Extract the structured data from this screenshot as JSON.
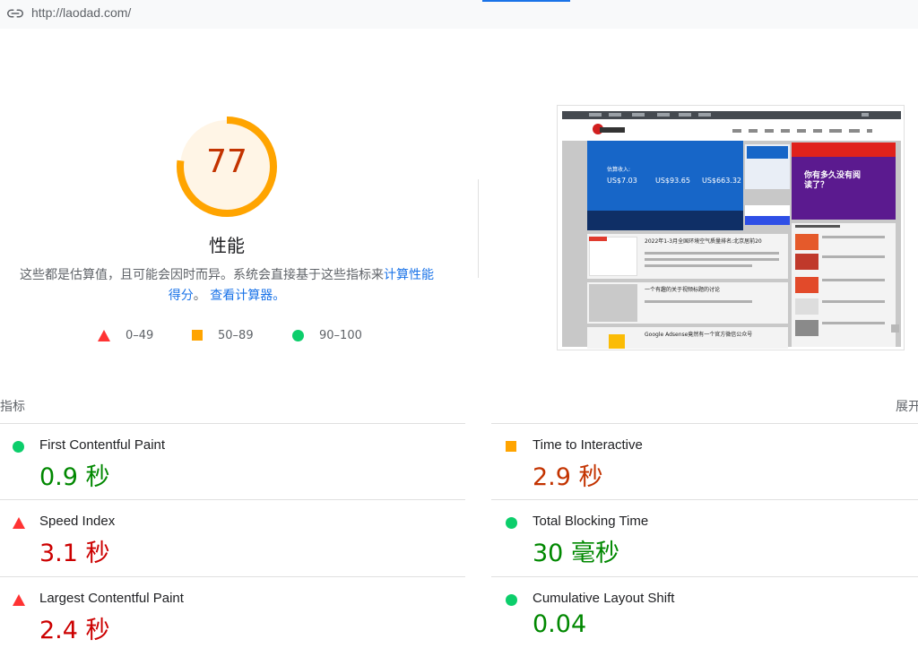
{
  "url_bar": {
    "url": "http://laodad.com/",
    "icon": "link-icon"
  },
  "score": {
    "value": "77",
    "label": "性能",
    "ring_fraction": 0.77,
    "color": "#ffa400",
    "text_color": "#c33300"
  },
  "description": {
    "text": "这些都是估算值，且可能会因时而异。系统会直接基于这些指标来",
    "link1": "计算性能得分",
    "mid": "。",
    "link2": "查看计算器。"
  },
  "legend": [
    {
      "shape": "triangle",
      "color": "#ff3333",
      "range": "0–49"
    },
    {
      "shape": "square",
      "color": "#ffa400",
      "range": "50–89"
    },
    {
      "shape": "circle",
      "color": "#0cce6b",
      "range": "90–100"
    }
  ],
  "metrics_section": {
    "title": "指标",
    "expand_label": "展开"
  },
  "metrics": [
    {
      "name": "First Contentful Paint",
      "value": "0.9 秒",
      "status": "pass"
    },
    {
      "name": "Time to Interactive",
      "value": "2.9 秒",
      "status": "average"
    },
    {
      "name": "Speed Index",
      "value": "3.1 秒",
      "status": "fail"
    },
    {
      "name": "Total Blocking Time",
      "value": "30 毫秒",
      "status": "pass"
    },
    {
      "name": "Largest Contentful Paint",
      "value": "2.4 秒",
      "status": "fail"
    },
    {
      "name": "Cumulative Layout Shift",
      "value": "0.04",
      "status": "pass"
    }
  ],
  "thumbnail": {
    "banner": {
      "l1": "估算收入:",
      "v1": "US$7.03",
      "v2": "US$93.65",
      "v3": "US$663.32"
    },
    "article1": "2022年1-3月全国环境空气质量排名:北京居前20",
    "article2": "一个有趣的关于视频标题的讨论",
    "article3": "Google Adsense竟然有一个官方微信公众号",
    "ad_text": "你有多久没有阅读了？"
  }
}
